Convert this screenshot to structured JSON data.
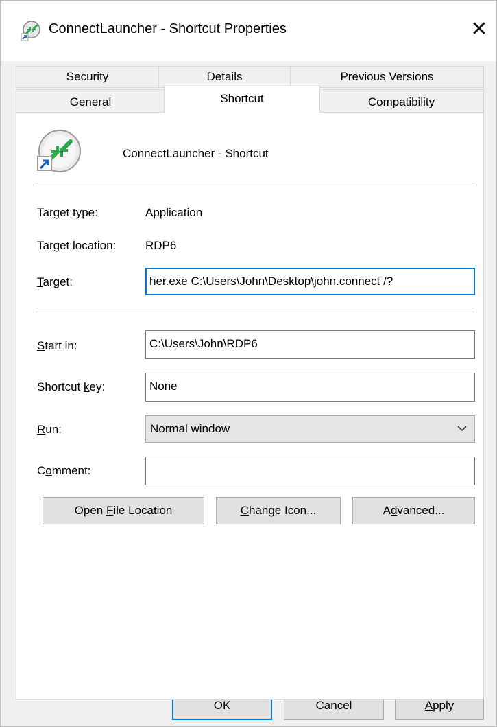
{
  "window": {
    "title": "ConnectLauncher - Shortcut Properties",
    "close_glyph": "✕"
  },
  "tabs": {
    "row1": [
      {
        "label": "Security"
      },
      {
        "label": "Details"
      },
      {
        "label": "Previous Versions"
      }
    ],
    "row2": [
      {
        "label": "General"
      },
      {
        "label": "Shortcut",
        "active": true
      },
      {
        "label": "Compatibility"
      }
    ]
  },
  "shortcut": {
    "name": "ConnectLauncher - Shortcut",
    "target_type_label": "Target type:",
    "target_type_value": "Application",
    "target_location_label": "Target location:",
    "target_location_value": "RDP6",
    "target_label_mn": "T",
    "target_label_rest": "arget:",
    "target_value": "her.exe C:\\Users\\John\\Desktop\\john.connect /?",
    "start_in_label_mn": "S",
    "start_in_label_rest": "tart in:",
    "start_in_value": "C:\\Users\\John\\RDP6",
    "shortcut_key_label_pre": "Shortcut ",
    "shortcut_key_label_mn": "k",
    "shortcut_key_label_rest": "ey:",
    "shortcut_key_value": "None",
    "run_label_mn": "R",
    "run_label_rest": "un:",
    "run_value": "Normal window",
    "comment_label_pre": "C",
    "comment_label_mn": "o",
    "comment_label_rest": "mment:",
    "comment_value": ""
  },
  "actions": {
    "open_file_location": {
      "pre": "Open ",
      "mn": "F",
      "rest": "ile Location"
    },
    "change_icon": {
      "pre": "",
      "mn": "C",
      "rest": "hange Icon..."
    },
    "advanced": {
      "pre": "A",
      "mn": "d",
      "rest": "vanced..."
    }
  },
  "footer": {
    "ok": "OK",
    "cancel": "Cancel",
    "apply_mn": "A",
    "apply_rest": "pply"
  },
  "colors": {
    "accent": "#0078d7",
    "window_bg": "#f0f0f0",
    "panel_bg": "#ffffff"
  },
  "icons": {
    "app": "remote-desktop-icon",
    "shortcut_overlay": "shortcut-arrow-icon",
    "dropdown": "chevron-down-icon",
    "close": "close-icon"
  }
}
